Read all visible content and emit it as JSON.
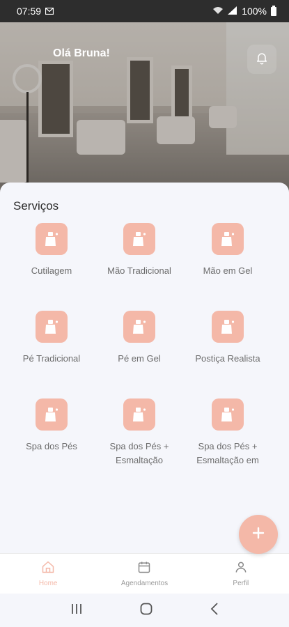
{
  "status_bar": {
    "time": "07:59",
    "battery": "100%"
  },
  "header": {
    "greeting": "Olá Bruna!"
  },
  "services": {
    "title": "Serviços",
    "items": [
      {
        "label": "Cutilagem"
      },
      {
        "label": "Mão Tradicional"
      },
      {
        "label": "Mão em Gel"
      },
      {
        "label": "Pé Tradicional"
      },
      {
        "label": "Pé em Gel"
      },
      {
        "label": "Postiça Realista"
      },
      {
        "label": "Spa dos Pés"
      },
      {
        "label": "Spa dos Pés + Esmaltação"
      },
      {
        "label": "Spa dos Pés + Esmaltação em"
      }
    ]
  },
  "bottom_nav": {
    "items": [
      {
        "label": "Home",
        "icon": "home-icon",
        "active": true
      },
      {
        "label": "Agendamentos",
        "icon": "calendar-icon",
        "active": false
      },
      {
        "label": "Perfil",
        "icon": "user-icon",
        "active": false
      }
    ]
  },
  "colors": {
    "accent": "#f4b8a8",
    "background": "#f5f6fb",
    "text": "#2a2a2a",
    "muted": "#6c6c6c"
  }
}
